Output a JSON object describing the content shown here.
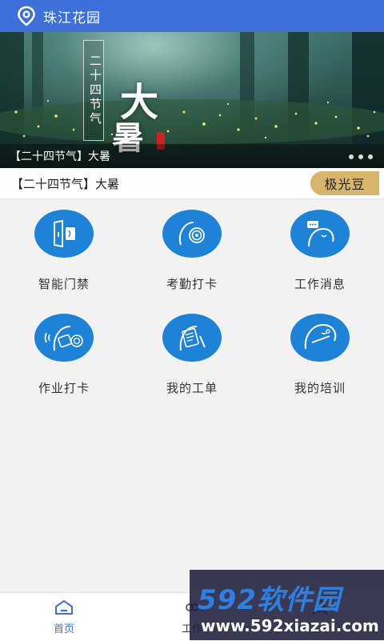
{
  "header": {
    "title": "珠江花园",
    "icon": "location-pin-icon"
  },
  "banner": {
    "vertical_text": "二十四节气",
    "big_char_1": "大",
    "big_char_2": "暑",
    "caption": "【二十四节气】大暑",
    "page_count": 3
  },
  "news": {
    "title": "【二十四节气】大暑"
  },
  "points_button": {
    "label": "极光豆"
  },
  "apps": [
    {
      "label": "智能门禁",
      "icon": "door-access-icon"
    },
    {
      "label": "考勤打卡",
      "icon": "fingerprint-checkin-icon"
    },
    {
      "label": "工作消息",
      "icon": "message-chat-icon"
    },
    {
      "label": "作业打卡",
      "icon": "nfc-card-tap-icon"
    },
    {
      "label": "我的工单",
      "icon": "work-order-icon"
    },
    {
      "label": "我的培训",
      "icon": "training-icon"
    }
  ],
  "bottom_nav": {
    "home": "首页",
    "work": "工作",
    "mine": ""
  },
  "watermark": {
    "brand": "592软件园",
    "url": "www.592xiazai.com"
  },
  "colors": {
    "header_bg": "#3f6fd9",
    "icon_bg": "#1e82d7",
    "points_bg": "#d8b56b",
    "active_nav": "#3f6fd9"
  }
}
